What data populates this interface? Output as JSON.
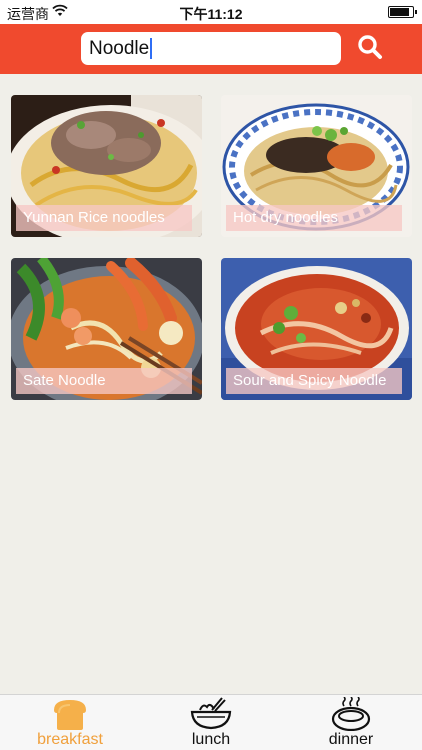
{
  "status_bar": {
    "carrier": "运营商",
    "time": "下午11:12",
    "battery_level": 0.9
  },
  "search": {
    "value": "Noodle",
    "icon": "search-icon"
  },
  "foods": [
    {
      "label": "Yunnan Rice noodles"
    },
    {
      "label": "Hot dry noodles"
    },
    {
      "label": "Sate Noodle"
    },
    {
      "label": "Sour and Spicy Noodle"
    }
  ],
  "tabs": [
    {
      "label": "breakfast",
      "icon": "bread-icon",
      "active": true
    },
    {
      "label": "lunch",
      "icon": "noodle-bowl-icon",
      "active": false
    },
    {
      "label": "dinner",
      "icon": "soup-pot-icon",
      "active": false
    }
  ],
  "colors": {
    "header": "#f04a2e",
    "background": "#f0efe9",
    "active_tab": "#f0a03c",
    "caret": "#2f6ef5"
  }
}
